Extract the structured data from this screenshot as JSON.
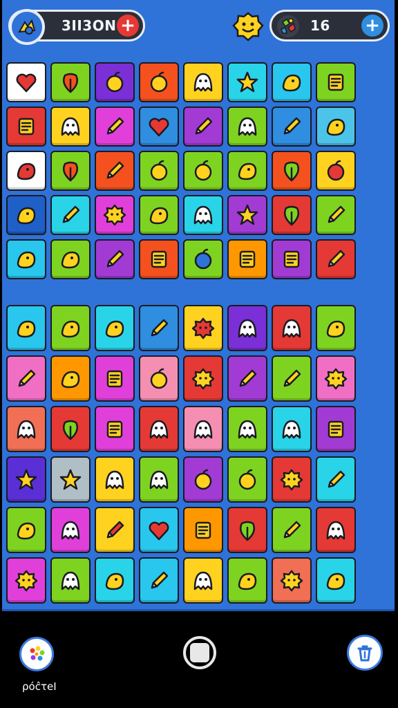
{
  "hud": {
    "left_value": "3ΙΙ3ΟΝ",
    "right_value": "16"
  },
  "bottom": {
    "palette_label": "ρόĉτeΙ"
  },
  "colors": {
    "board": "#2f72d8",
    "pill": "#2b2f3a",
    "accent_red": "#e53935",
    "accent_blue": "#2f8ee0"
  },
  "grid_top": [
    [
      {
        "c": "#ffffff",
        "i": "heart-icon"
      },
      {
        "c": "#7ed321",
        "i": "leaf-blob-icon"
      },
      {
        "c": "#7b2fd6",
        "i": "ring-gem-icon"
      },
      {
        "c": "#f4511e",
        "i": "ring-icon"
      },
      {
        "c": "#ffd21f",
        "i": "tiger-face-icon"
      },
      {
        "c": "#29d4e8",
        "i": "star-creature-icon"
      },
      {
        "c": "#29c6ee",
        "i": "lemon-icon"
      },
      {
        "c": "#7ed321",
        "i": "card-icon"
      }
    ],
    [
      {
        "c": "#e53935",
        "i": "burger-icon"
      },
      {
        "c": "#ffd21f",
        "i": "pink-monster-icon"
      },
      {
        "c": "#e040d9",
        "i": "pencil-icon"
      },
      {
        "c": "#2f8ee0",
        "i": "heart-icon"
      },
      {
        "c": "#a23bd4",
        "i": "brush-icon"
      },
      {
        "c": "#7ed321",
        "i": "ladybug-icon"
      },
      {
        "c": "#2f8ee0",
        "i": "crayon-icon"
      },
      {
        "c": "#4cc3e8",
        "i": "airplane-icon"
      }
    ],
    [
      {
        "c": "#ffffff",
        "i": "popsicle-icon"
      },
      {
        "c": "#7ed321",
        "i": "tulip-icon"
      },
      {
        "c": "#f4511e",
        "i": "pencil-icon"
      },
      {
        "c": "#7ed321",
        "i": "apple-icon"
      },
      {
        "c": "#7ed321",
        "i": "coconut-icon"
      },
      {
        "c": "#7ed321",
        "i": "bird-icon"
      },
      {
        "c": "#f4511e",
        "i": "pepper-icon"
      },
      {
        "c": "#ffd21f",
        "i": "donut-icon"
      }
    ],
    [
      {
        "c": "#1f5fc8",
        "i": "rocket-icon"
      },
      {
        "c": "#29d4e8",
        "i": "pencil-icon"
      },
      {
        "c": "#e040d9",
        "i": "gear-icon"
      },
      {
        "c": "#7ed321",
        "i": "tools-icon"
      },
      {
        "c": "#29d4e8",
        "i": "robot-icon"
      },
      {
        "c": "#a23bd4",
        "i": "star-icon"
      },
      {
        "c": "#e53935",
        "i": "tree-icon"
      },
      {
        "c": "#7ed321",
        "i": "pencil-icon"
      }
    ],
    [
      {
        "c": "#29c6ee",
        "i": "pizza-slice-icon"
      },
      {
        "c": "#7ed321",
        "i": "mango-icon"
      },
      {
        "c": "#a23bd4",
        "i": "pencil-icon"
      },
      {
        "c": "#f4511e",
        "i": "notebook-icon"
      },
      {
        "c": "#7ed321",
        "i": "blueberry-icon"
      },
      {
        "c": "#ff9800",
        "i": "usb-drive-icon"
      },
      {
        "c": "#a23bd4",
        "i": "book-stack-icon"
      },
      {
        "c": "#e53935",
        "i": "crayon-icon"
      }
    ]
  ],
  "grid_bottom": [
    [
      {
        "c": "#29c6ee",
        "i": "cheese-icon"
      },
      {
        "c": "#7ed321",
        "i": "snail-icon"
      },
      {
        "c": "#29d4e8",
        "i": "fish-icon"
      },
      {
        "c": "#2f8ee0",
        "i": "pencil-icon"
      },
      {
        "c": "#ffd21f",
        "i": "virus-face-icon"
      },
      {
        "c": "#7b2fd6",
        "i": "ghost-face-icon"
      },
      {
        "c": "#e53935",
        "i": "pig-face-icon"
      },
      {
        "c": "#7ed321",
        "i": "sneaker-icon"
      }
    ],
    [
      {
        "c": "#f06fc4",
        "i": "pencil-icon"
      },
      {
        "c": "#ff9800",
        "i": "seed-icon"
      },
      {
        "c": "#e040d9",
        "i": "calculator-icon"
      },
      {
        "c": "#f48fb1",
        "i": "donut-eye-icon"
      },
      {
        "c": "#e53935",
        "i": "sun-gear-icon"
      },
      {
        "c": "#a23bd4",
        "i": "paintbrush-icon"
      },
      {
        "c": "#7ed321",
        "i": "pencil-icon"
      },
      {
        "c": "#f06fc4",
        "i": "flower-icon"
      }
    ],
    [
      {
        "c": "#f06f55",
        "i": "bug-icon"
      },
      {
        "c": "#e53935",
        "i": "leaf-icon"
      },
      {
        "c": "#e040d9",
        "i": "monitor-icon"
      },
      {
        "c": "#e53935",
        "i": "ghost-icon"
      },
      {
        "c": "#f48fb1",
        "i": "blob-face-icon"
      },
      {
        "c": "#7ed321",
        "i": "cat-face-icon"
      },
      {
        "c": "#29d4e8",
        "i": "ghost-icon"
      },
      {
        "c": "#a23bd4",
        "i": "box-icon"
      }
    ],
    [
      {
        "c": "#5b2fd6",
        "i": "splat-icon"
      },
      {
        "c": "#b0bec5",
        "i": "star-icon"
      },
      {
        "c": "#ffd21f",
        "i": "smiley-icon"
      },
      {
        "c": "#7ed321",
        "i": "octopus-icon"
      },
      {
        "c": "#a23bd4",
        "i": "donut-icon"
      },
      {
        "c": "#7ed321",
        "i": "apple-icon"
      },
      {
        "c": "#e53935",
        "i": "gear-monster-icon"
      },
      {
        "c": "#29d4e8",
        "i": "pencil-icon"
      }
    ],
    [
      {
        "c": "#7ed321",
        "i": "mango-icon"
      },
      {
        "c": "#e040d9",
        "i": "lemon-face-icon"
      },
      {
        "c": "#ffd21f",
        "i": "pencil-icon"
      },
      {
        "c": "#29c6ee",
        "i": "heart-icon"
      },
      {
        "c": "#ff9800",
        "i": "phone-icon"
      },
      {
        "c": "#e53935",
        "i": "eggplant-icon"
      },
      {
        "c": "#7ed321",
        "i": "pencil-icon"
      },
      {
        "c": "#e53935",
        "i": "bear-face-icon"
      }
    ],
    [
      {
        "c": "#e040d9",
        "i": "flower-face-icon"
      },
      {
        "c": "#7ed321",
        "i": "monster-mouth-icon"
      },
      {
        "c": "#29d4e8",
        "i": "banana-icon"
      },
      {
        "c": "#29c6ee",
        "i": "crayon-icon"
      },
      {
        "c": "#ffd21f",
        "i": "blob-face-icon"
      },
      {
        "c": "#7ed321",
        "i": "bowl-icon"
      },
      {
        "c": "#f06f55",
        "i": "virus-face-icon"
      },
      {
        "c": "#29d4e8",
        "i": "duck-icon"
      }
    ]
  ]
}
